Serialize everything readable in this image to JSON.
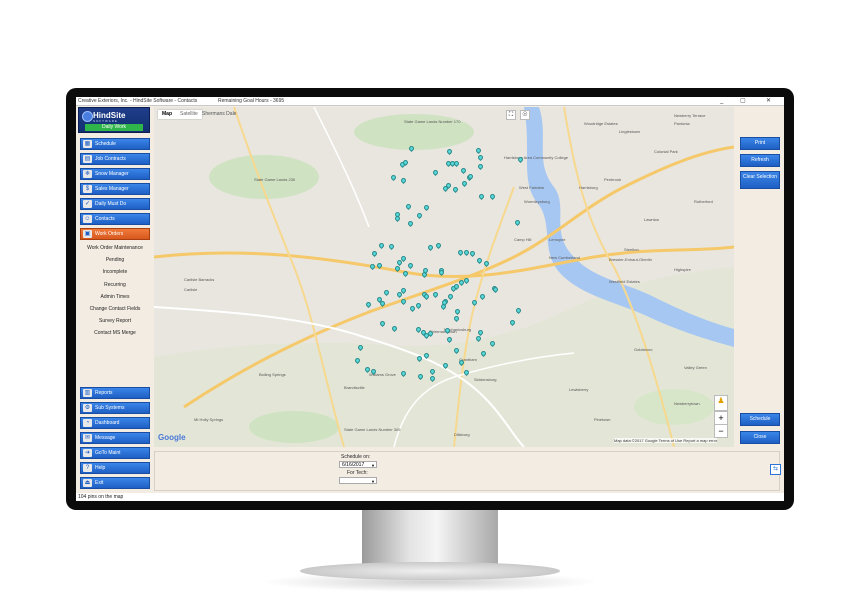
{
  "window": {
    "title": "Creative Exteriors, Inc. - HindSite Software - Contacts",
    "remaining_goal": "Remaining Goal Hours - 3695",
    "controls": {
      "minimize": "_",
      "maximize": "▢",
      "close": "✕"
    }
  },
  "logo": {
    "name": "HindSite",
    "tagline": "SOFTWARE",
    "badge": "Daily Work"
  },
  "sidebar": {
    "top_buttons": [
      {
        "label": "Schedule",
        "icon": "calendar-icon"
      },
      {
        "label": "Job Contracts",
        "icon": "clipboard-icon"
      },
      {
        "label": "Snow Manager",
        "icon": "snow-icon"
      },
      {
        "label": "Sales Manager",
        "icon": "dollar-icon"
      },
      {
        "label": "Daily Must Do",
        "icon": "checklist-icon"
      },
      {
        "label": "Contacts",
        "icon": "contacts-icon"
      },
      {
        "label": "Work Orders",
        "icon": "work-order-icon",
        "active": true
      }
    ],
    "submenu": [
      "Work Order Maintenance",
      "Pending",
      "Incomplete",
      "Recurring",
      "Admin Times",
      "Change Contact Fields",
      "Survey Report",
      "Contact MS Merge"
    ],
    "bottom_buttons": [
      {
        "label": "Reports",
        "icon": "reports-icon"
      },
      {
        "label": "Sub Systems",
        "icon": "subsystems-icon"
      },
      {
        "label": "Dashboard",
        "icon": "dashboard-icon"
      },
      {
        "label": "Message",
        "icon": "message-icon"
      },
      {
        "label": "GoTo Maint",
        "icon": "goto-icon"
      },
      {
        "label": "Help",
        "icon": "help-icon"
      },
      {
        "label": "Exit",
        "icon": "exit-icon"
      }
    ]
  },
  "map": {
    "tabs": [
      "Map",
      "Satellite"
    ],
    "top_label": "Shermans Dale",
    "places": [
      "State Game Lands Number 170",
      "Harrisburg Area Community College",
      "Woodridge Estates",
      "Linglestown",
      "Paxtonia",
      "Colonial Park",
      "Penbrook",
      "Harrisburg",
      "West Fairview",
      "Wormleysburg",
      "Lawnton",
      "Rutherford",
      "Camp Hill",
      "Lemoyne",
      "New Cumberland",
      "Steelton",
      "Bressler-Enhaut-Oberlin",
      "Highspire",
      "Westfield Estates",
      "State Game Lands 230",
      "Carlisle Barracks",
      "Carlisle",
      "Boiling Springs",
      "Williams Grove",
      "Mechanicsburg",
      "Shiremanstown",
      "Grantham",
      "Siddonsburg",
      "Brandtsville",
      "Mt Holly Springs",
      "Dillsburg",
      "Pinetown",
      "Newberrytown",
      "Valley Green",
      "State Game Lands Number 305",
      "Lewisberry",
      "Goldsboro",
      "Newberry Terrace"
    ],
    "google": "Google",
    "footer": "Map data ©2017 Google   Terms of Use   Report a map error",
    "zoom_in": "+",
    "zoom_out": "−"
  },
  "right_buttons": {
    "print": "Print",
    "refresh": "Refresh",
    "clear": "Clear Selection",
    "schedule": "Schedule",
    "close": "Close"
  },
  "bottom_panel": {
    "schedule_on_label": "Schedule on:",
    "schedule_date": "6/16/2017",
    "for_tech_label": "For Tech:",
    "for_tech_value": ""
  },
  "status": {
    "text": "104 pins on the map"
  },
  "colors": {
    "button_blue": "#2b73d6",
    "active_orange": "#e8692c",
    "pin": "#56d6d6",
    "badge_green": "#2fb54a"
  }
}
